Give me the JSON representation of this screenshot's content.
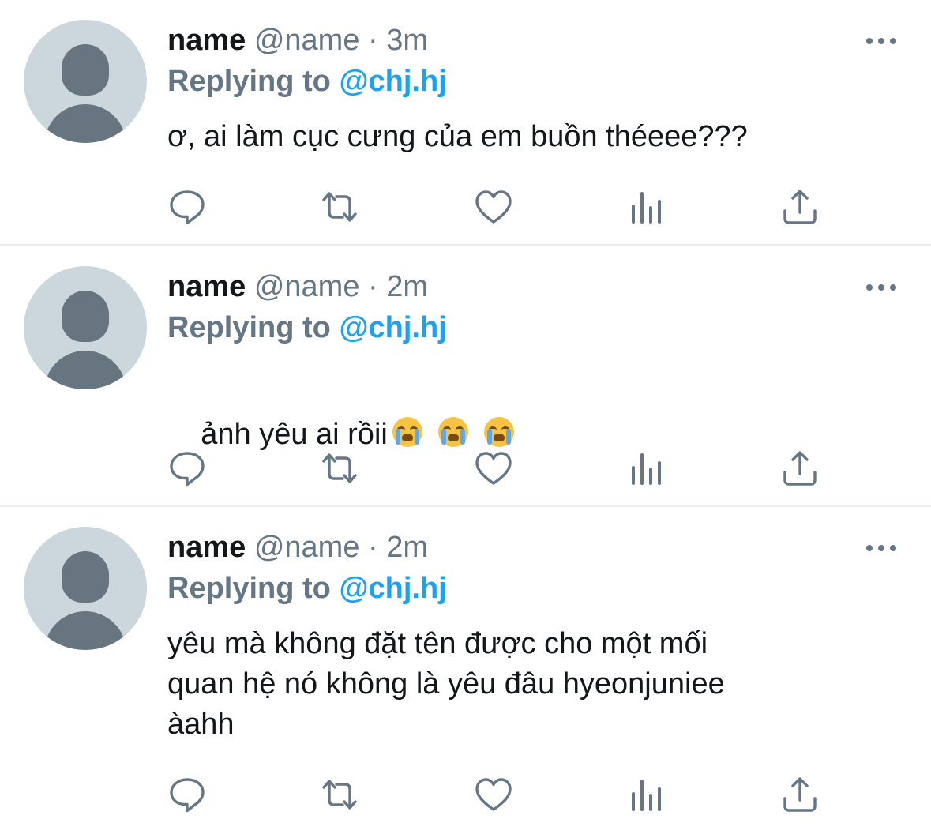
{
  "tweets": [
    {
      "name": "name",
      "handle": "@name",
      "time": "3m",
      "replying_label": "Replying to",
      "replying_handle": "@chj.hj",
      "text": "ơ, ai làm cục cưng của em buồn théeee???"
    },
    {
      "name": "name",
      "handle": "@name",
      "time": "2m",
      "replying_label": "Replying to",
      "replying_handle": "@chj.hj",
      "text": "ảnh yêu ai rồii",
      "emojis": [
        "loudly-crying-face-emoji",
        "loudly-crying-face-emoji",
        "loudly-crying-face-emoji"
      ]
    },
    {
      "name": "name",
      "handle": "@name",
      "time": "2m",
      "replying_label": "Replying to",
      "replying_handle": "@chj.hj",
      "text": "yêu mà không đặt tên được cho một mối\nquan hệ nó không là yêu đâu hyeonjuniee\nàahh"
    }
  ],
  "separator": "·",
  "icons": {
    "reply": "reply-icon",
    "retweet": "retweet-icon",
    "like": "heart-icon",
    "analytics": "analytics-icon",
    "share": "share-icon",
    "more": "more-dots-icon"
  },
  "colors": {
    "text": "#14171a",
    "secondary": "#657786",
    "link": "#1da1f2",
    "avatar_bg": "#ccd6dd",
    "avatar_fg": "#66757f",
    "divider": "#ebeef0"
  }
}
